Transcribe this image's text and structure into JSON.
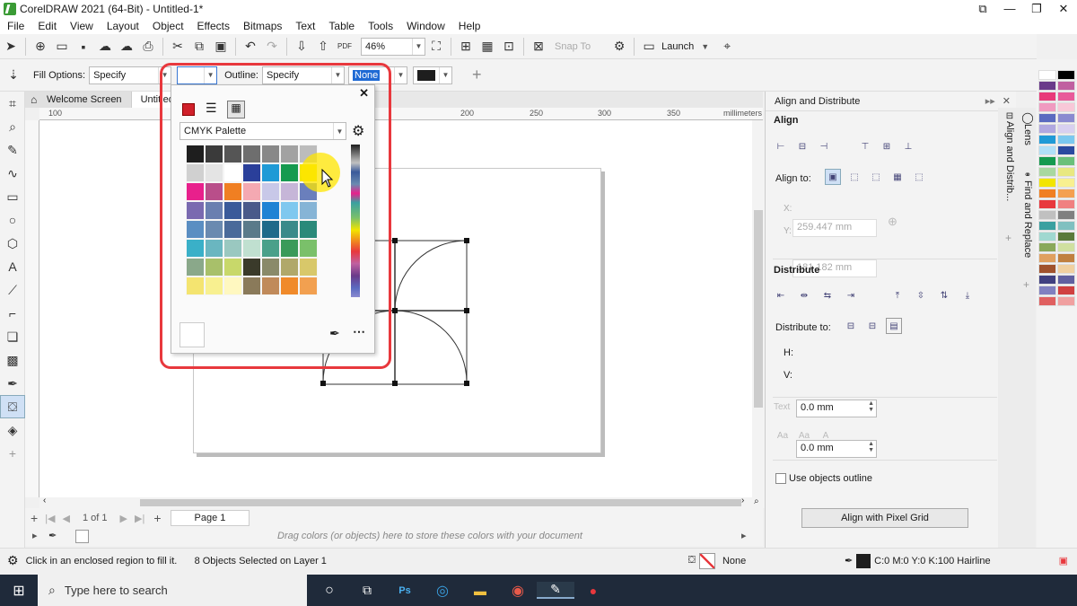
{
  "window": {
    "title": "CorelDRAW 2021 (64-Bit) - Untitled-1*"
  },
  "menu": [
    "File",
    "Edit",
    "View",
    "Layout",
    "Object",
    "Effects",
    "Bitmaps",
    "Text",
    "Table",
    "Tools",
    "Window",
    "Help"
  ],
  "toolbar": {
    "zoom": "46%",
    "snap_to": "Snap To",
    "launch": "Launch"
  },
  "propbar": {
    "fill_label": "Fill Options:",
    "fill_value": "Specify",
    "outline_label": "Outline:",
    "outline_value": "Specify",
    "none_value": "None"
  },
  "tabs": {
    "welcome": "Welcome Screen",
    "doc": "Untitled"
  },
  "ruler": {
    "units": "millimeters",
    "ticks": [
      "100",
      "200",
      "250",
      "300",
      "350"
    ]
  },
  "popup": {
    "palette_name": "CMYK Palette"
  },
  "palette_colors": [
    "#1e1e1e",
    "#3a3a3a",
    "#555555",
    "#6e6e6e",
    "#888888",
    "#a2a2a2",
    "#bcbcbc",
    "#d0d0d0",
    "#e4e4e4",
    "#ffffff",
    "#2a3f9a",
    "#1f9ad6",
    "#159a4f",
    "#f2e500",
    "#e8208c",
    "#b94e8a",
    "#f07f22",
    "#f4a9b2",
    "#c8c8e8",
    "#c6b6d8",
    "#6a7fbc",
    "#7a6ab0",
    "#6a7fb0",
    "#3a5a9a",
    "#4a5a8a",
    "#1f83d4",
    "#7fc8ef",
    "#86b4d6",
    "#5a8ec2",
    "#6a8ab0",
    "#4a6a9a",
    "#5a7a8a",
    "#1f6a8a",
    "#3a8a8a",
    "#2a8a7a",
    "#3ab0c8",
    "#6ab6c0",
    "#9ac8c0",
    "#c0e0d0",
    "#4aa08a",
    "#3a9a5a",
    "#7ac06a",
    "#8aa88a",
    "#a8c06a",
    "#c8d86a",
    "#3a3a2a",
    "#8a8a6a",
    "#b0a86a",
    "#d8c86a",
    "#f4e470",
    "#f8f090",
    "#fff8c0",
    "#8a7a5a",
    "#c08a5a",
    "#f08a2a",
    "#f2a050"
  ],
  "docker": {
    "title": "Align and Distribute",
    "align": "Align",
    "align_to": "Align to:",
    "x": "259.447 mm",
    "y": "181.182 mm",
    "x_label": "X:",
    "y_label": "Y:",
    "distribute": "Distribute",
    "distribute_to": "Distribute to:",
    "h_label": "H:",
    "h_value": "0.0 mm",
    "v_label": "V:",
    "v_value": "0.0 mm",
    "text": "Text",
    "use_outline": "Use objects outline",
    "pixel_grid": "Align with Pixel Grid"
  },
  "docker_tabs": {
    "lens": "Lens",
    "align": "Align and Distrib...",
    "find": "Find and Replace"
  },
  "pagebar": {
    "page_count": "1 of 1",
    "page_label": "Page 1"
  },
  "colorbar_hint": "Drag colors (or objects) here to store these colors with your document",
  "status": {
    "hint": "Click in an enclosed region to fill it.",
    "selection": "8 Objects Selected on Layer 1",
    "fill": "None",
    "outline": "C:0 M:0 Y:0 K:100  Hairline"
  },
  "taskbar": {
    "search_placeholder": "Type here to search"
  },
  "right_palette": [
    "#ffffff",
    "#000000",
    "#6a3a8a",
    "#c060a0",
    "#e83a7a",
    "#e85a9a",
    "#f09ac0",
    "#f8c8d8",
    "#5a6ac0",
    "#8a8ad0",
    "#b0a8e0",
    "#d8d0f0",
    "#1f9ad6",
    "#7ac8ef",
    "#b0e0f8",
    "#2a4aa0",
    "#159a4f",
    "#6ac07a",
    "#a8d8a0",
    "#e8e880",
    "#f2e500",
    "#f8f090",
    "#f07f22",
    "#f4a050",
    "#e8383d",
    "#f08080",
    "#c0c0c0",
    "#808080",
    "#3aa0a0",
    "#80c0c0",
    "#a0d8d0",
    "#5a7a3a",
    "#8aa85a",
    "#d0e0a0",
    "#e0a060",
    "#c08040",
    "#a0522d",
    "#f0d0a0",
    "#404080",
    "#6060a0",
    "#8080c0",
    "#d04040",
    "#e06060",
    "#f0a0a0"
  ]
}
